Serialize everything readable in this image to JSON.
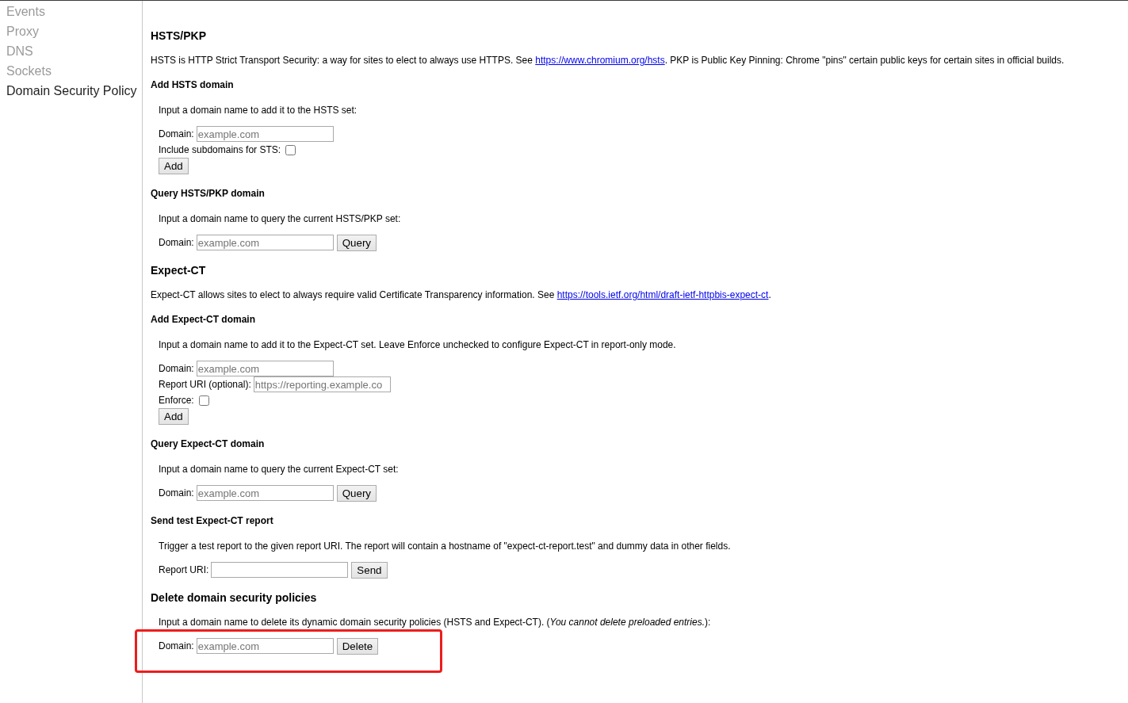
{
  "sidebar": {
    "items": [
      {
        "label": "Events",
        "selected": false
      },
      {
        "label": "Proxy",
        "selected": false
      },
      {
        "label": "DNS",
        "selected": false
      },
      {
        "label": "Sockets",
        "selected": false
      },
      {
        "label": "Domain Security Policy",
        "selected": true
      }
    ]
  },
  "content": [
    {
      "kind": "title",
      "text": "HSTS/PKP"
    },
    {
      "kind": "description",
      "parts": [
        {
          "kind": "text",
          "text": "HSTS is HTTP Strict Transport Security: a way for sites to elect to always use HTTPS. See "
        },
        {
          "kind": "link",
          "text": "https://www.chromium.org/hsts"
        },
        {
          "kind": "text",
          "text": ". PKP is Public Key Pinning: Chrome \"pins\" certain public keys for certain sites in official builds."
        }
      ]
    },
    {
      "kind": "subtitle",
      "text": "Add HSTS domain"
    },
    {
      "kind": "form",
      "intro": "Input a domain name to add it to the HSTS set:",
      "highlighted": false,
      "rows": [
        [
          {
            "kind": "field",
            "label": "Domain:",
            "placeholder": "example.com"
          }
        ],
        [
          {
            "kind": "checkbox",
            "label": "Include subdomains for STS:",
            "checked": false
          }
        ],
        [
          {
            "kind": "button",
            "label": "Add"
          }
        ]
      ]
    },
    {
      "kind": "subtitle",
      "text": "Query HSTS/PKP domain"
    },
    {
      "kind": "form",
      "intro": "Input a domain name to query the current HSTS/PKP set:",
      "highlighted": false,
      "rows": [
        [
          {
            "kind": "field",
            "label": "Domain:",
            "placeholder": "example.com"
          },
          {
            "kind": "button",
            "label": "Query"
          }
        ]
      ]
    },
    {
      "kind": "title",
      "text": "Expect-CT"
    },
    {
      "kind": "description",
      "parts": [
        {
          "kind": "text",
          "text": "Expect-CT allows sites to elect to always require valid Certificate Transparency information. See "
        },
        {
          "kind": "link",
          "text": "https://tools.ietf.org/html/draft-ietf-httpbis-expect-ct"
        },
        {
          "kind": "text",
          "text": "."
        }
      ]
    },
    {
      "kind": "subtitle",
      "text": "Add Expect-CT domain"
    },
    {
      "kind": "form",
      "intro": "Input a domain name to add it to the Expect-CT set. Leave Enforce unchecked to configure Expect-CT in report-only mode.",
      "highlighted": false,
      "rows": [
        [
          {
            "kind": "field",
            "label": "Domain:",
            "placeholder": "example.com"
          }
        ],
        [
          {
            "kind": "field",
            "label": "Report URI (optional):",
            "placeholder": "https://reporting.example.co"
          }
        ],
        [
          {
            "kind": "checkbox",
            "label": "Enforce:",
            "checked": false
          }
        ],
        [
          {
            "kind": "button",
            "label": "Add"
          }
        ]
      ]
    },
    {
      "kind": "subtitle",
      "text": "Query Expect-CT domain"
    },
    {
      "kind": "form",
      "intro": "Input a domain name to query the current Expect-CT set:",
      "highlighted": false,
      "rows": [
        [
          {
            "kind": "field",
            "label": "Domain:",
            "placeholder": "example.com"
          },
          {
            "kind": "button",
            "label": "Query"
          }
        ]
      ]
    },
    {
      "kind": "subtitle",
      "text": "Send test Expect-CT report"
    },
    {
      "kind": "form",
      "intro": "Trigger a test report to the given report URI. The report will contain a hostname of \"expect-ct-report.test\" and dummy data in other fields.",
      "highlighted": false,
      "rows": [
        [
          {
            "kind": "field",
            "label": "Report URI:"
          },
          {
            "kind": "button",
            "label": "Send"
          }
        ]
      ]
    },
    {
      "kind": "title",
      "text": "Delete domain security policies"
    },
    {
      "kind": "form",
      "intro": "Input a domain name to delete its dynamic domain security policies (HSTS and Expect-CT). (*You cannot delete preloaded entries.*):",
      "highlighted": true,
      "rows": [
        [
          {
            "kind": "field",
            "label": "Domain:",
            "placeholder": "example.com"
          },
          {
            "kind": "button",
            "label": "Delete"
          }
        ]
      ]
    }
  ]
}
